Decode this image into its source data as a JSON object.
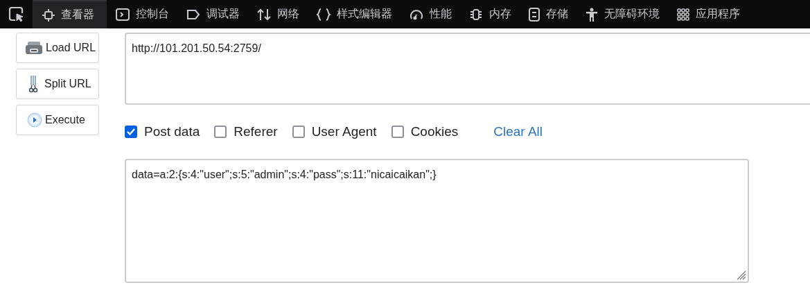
{
  "toolbar": {
    "tabs": [
      {
        "label": "查看器",
        "selected": true
      },
      {
        "label": "控制台",
        "selected": false
      },
      {
        "label": "调试器",
        "selected": false
      },
      {
        "label": "网络",
        "selected": false
      },
      {
        "label": "样式编辑器",
        "selected": false
      },
      {
        "label": "性能",
        "selected": false
      },
      {
        "label": "内存",
        "selected": false
      },
      {
        "label": "存储",
        "selected": false
      },
      {
        "label": "无障碍环境",
        "selected": false
      },
      {
        "label": "应用程序",
        "selected": false
      }
    ]
  },
  "actions": [
    "Load URL",
    "Split URL",
    "Execute"
  ],
  "url": {
    "value": "http://101.201.50.54:2759/"
  },
  "options": [
    {
      "label": "Post data",
      "checked": true
    },
    {
      "label": "Referer",
      "checked": false
    },
    {
      "label": "User Agent",
      "checked": false
    },
    {
      "label": "Cookies",
      "checked": false
    }
  ],
  "clear_all": "Clear All",
  "post_data": {
    "value": "data=a:2:{s:4:\"user\";s:5:\"admin\";s:4:\"pass\";s:11:\"nicaicaikan\";}"
  }
}
